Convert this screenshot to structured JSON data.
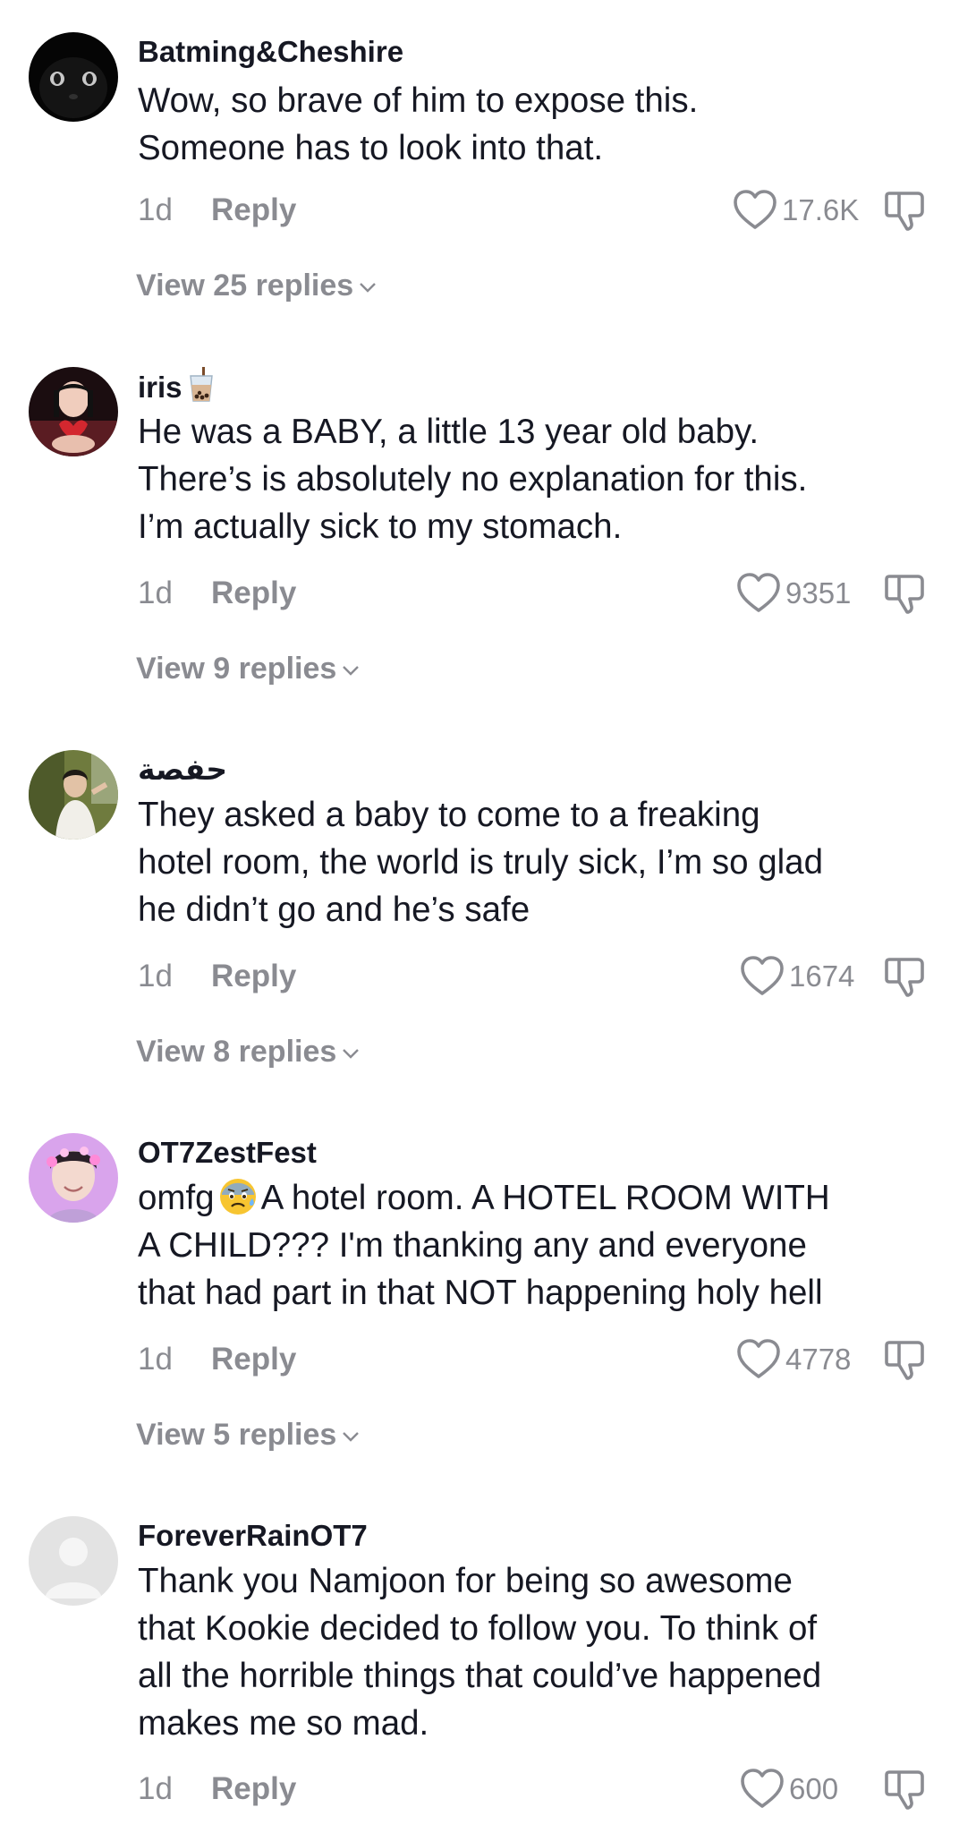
{
  "comments": [
    {
      "username": "Batming&Cheshire",
      "lines": [
        "Wow, so brave of him to expose this.",
        "Someone has to look into that."
      ],
      "time": "1d",
      "reply_label": "Reply",
      "likes": "17.6K",
      "view_replies": "View 25 replies"
    },
    {
      "username": "iris",
      "lines": [
        "He was a BABY, a little 13 year old baby.",
        "There’s is absolutely no explanation for this.",
        "I’m actually sick to my stomach."
      ],
      "time": "1d",
      "reply_label": "Reply",
      "likes": "9351",
      "view_replies": "View 9 replies"
    },
    {
      "username": "حفصة",
      "lines": [
        "They asked a baby to come to a freaking",
        "hotel room, the world is truly sick, I’m so glad",
        "he didn’t go and he’s safe"
      ],
      "time": "1d",
      "reply_label": "Reply",
      "likes": "1674",
      "view_replies": "View 8 replies"
    },
    {
      "username": "OT7ZestFest",
      "line1_before_emoji": "omfg",
      "line1_after_emoji": "A hotel room. A HOTEL ROOM WITH",
      "lines": [
        "A CHILD??? I'm thanking any and everyone",
        "that had part in that NOT happening holy hell"
      ],
      "time": "1d",
      "reply_label": "Reply",
      "likes": "4778",
      "view_replies": "View 5 replies"
    },
    {
      "username": "ForeverRainOT7",
      "lines": [
        "Thank you Namjoon for being so awesome",
        "that Kookie decided to follow you. To think of",
        "all the horrible things that could’ve happened",
        "makes me so mad."
      ],
      "time": "1d",
      "reply_label": "Reply",
      "likes": "600"
    }
  ],
  "icons": {
    "like": "heart-outline-icon",
    "dislike": "thumbs-down-outline-icon",
    "expand": "chevron-down-icon",
    "username_badge": "bubble-tea-icon",
    "inline_emoji": "anxious-face-icon"
  },
  "colors": {
    "text": "#161823",
    "secondary": "#8a8b91",
    "background": "#ffffff"
  }
}
